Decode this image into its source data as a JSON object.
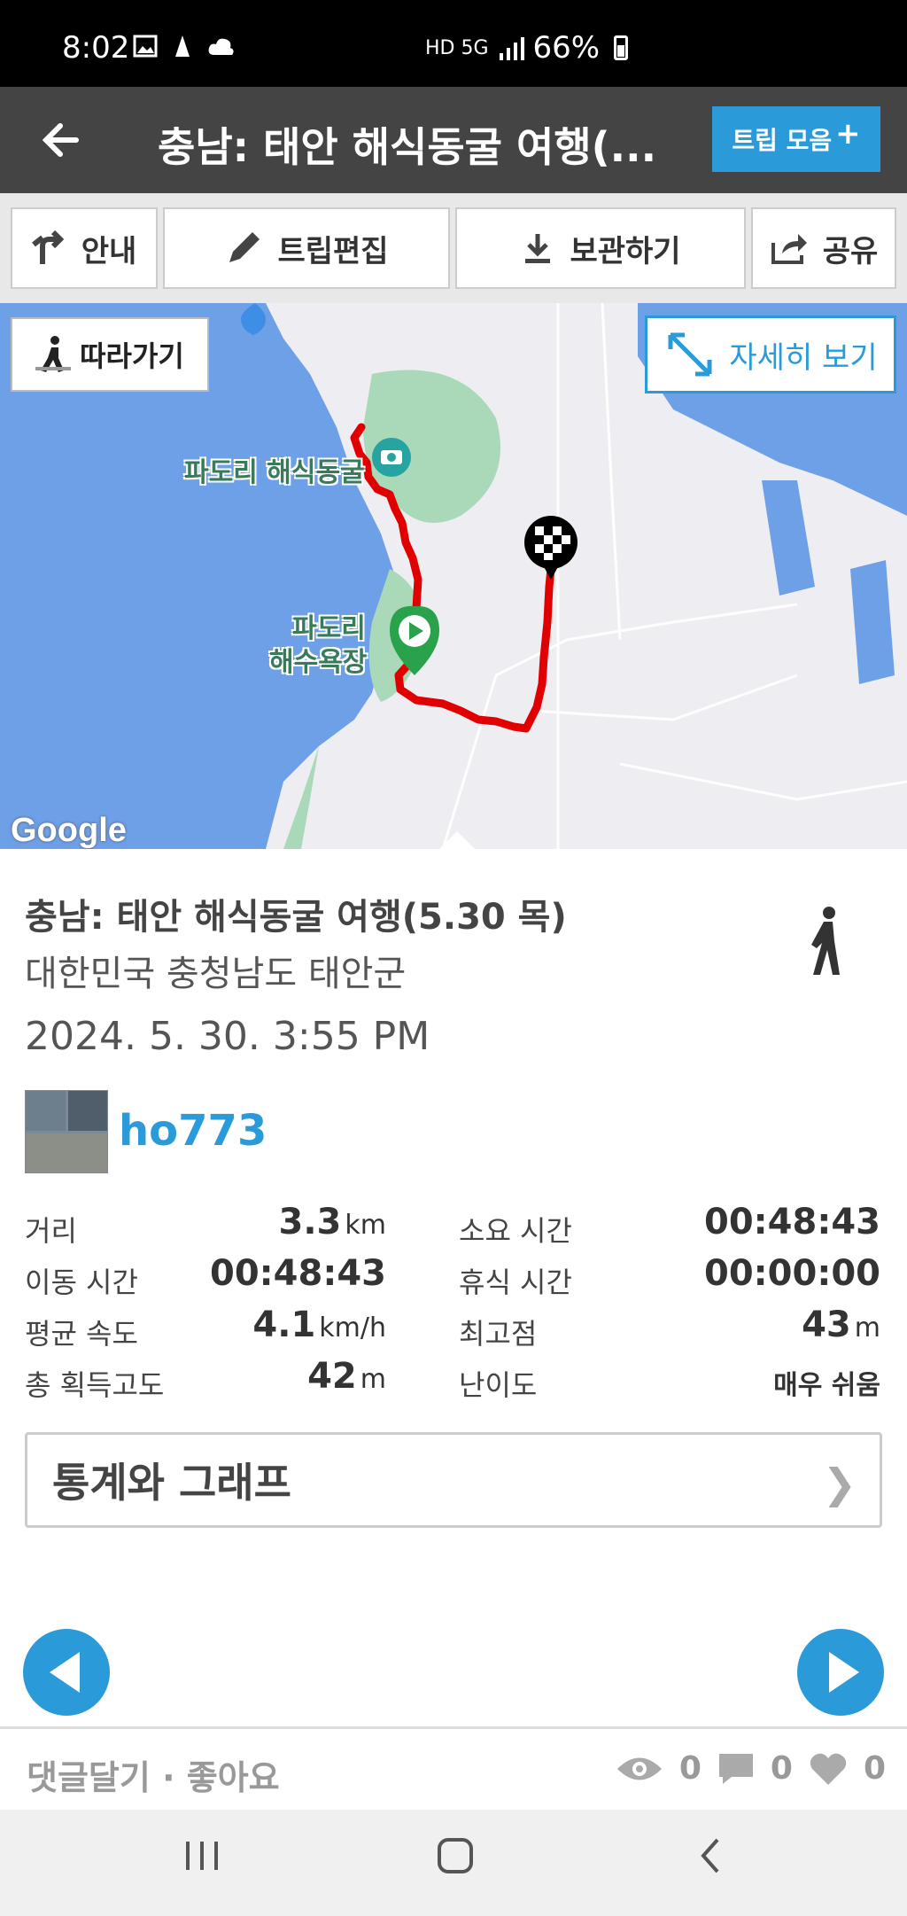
{
  "status_bar": {
    "time": "8:02",
    "network": "HD 5G",
    "battery": "66%"
  },
  "header": {
    "back_icon": "arrow-left",
    "title": "충남: 태안 해식동굴 여행(...",
    "trip_button": "트립 모음"
  },
  "toolbar": {
    "guide": "안내",
    "edit": "트립편집",
    "save": "보관하기",
    "share": "공유"
  },
  "map": {
    "follow_button": "따라가기",
    "detail_button": "자세히 보기",
    "place_cave": "파도리 해식동굴",
    "place_beach_line1": "파도리",
    "place_beach_line2": "해수욕장",
    "attribution": "Google",
    "route_color": "#e00000"
  },
  "trip": {
    "title": "충남: 태안 해식동굴 여행(5.30 목)",
    "location": "대한민국 충청남도 태안군",
    "datetime": "2024. 5. 30. 3:55 PM",
    "activity_icon": "walking-icon",
    "username": "ho773"
  },
  "stats": {
    "distance_label": "거리",
    "distance_value": "3.3",
    "distance_unit": "km",
    "duration_label": "소요 시간",
    "duration_value": "00:48:43",
    "moving_label": "이동 시간",
    "moving_value": "00:48:43",
    "rest_label": "휴식 시간",
    "rest_value": "00:00:00",
    "speed_label": "평균 속도",
    "speed_value": "4.1",
    "speed_unit": "km/h",
    "max_alt_label": "최고점",
    "max_alt_value": "43",
    "max_alt_unit": "m",
    "gain_label": "총 획득고도",
    "gain_value": "42",
    "gain_unit": "m",
    "difficulty_label": "난이도",
    "difficulty_value": "매우 쉬움"
  },
  "stats_button": "통계와 그래프",
  "footer": {
    "comment_like": "댓글달기 · 좋아요",
    "views": "0",
    "comments": "0",
    "likes": "0"
  },
  "colors": {
    "accent": "#2b9ad8",
    "header_bg": "#444444"
  }
}
